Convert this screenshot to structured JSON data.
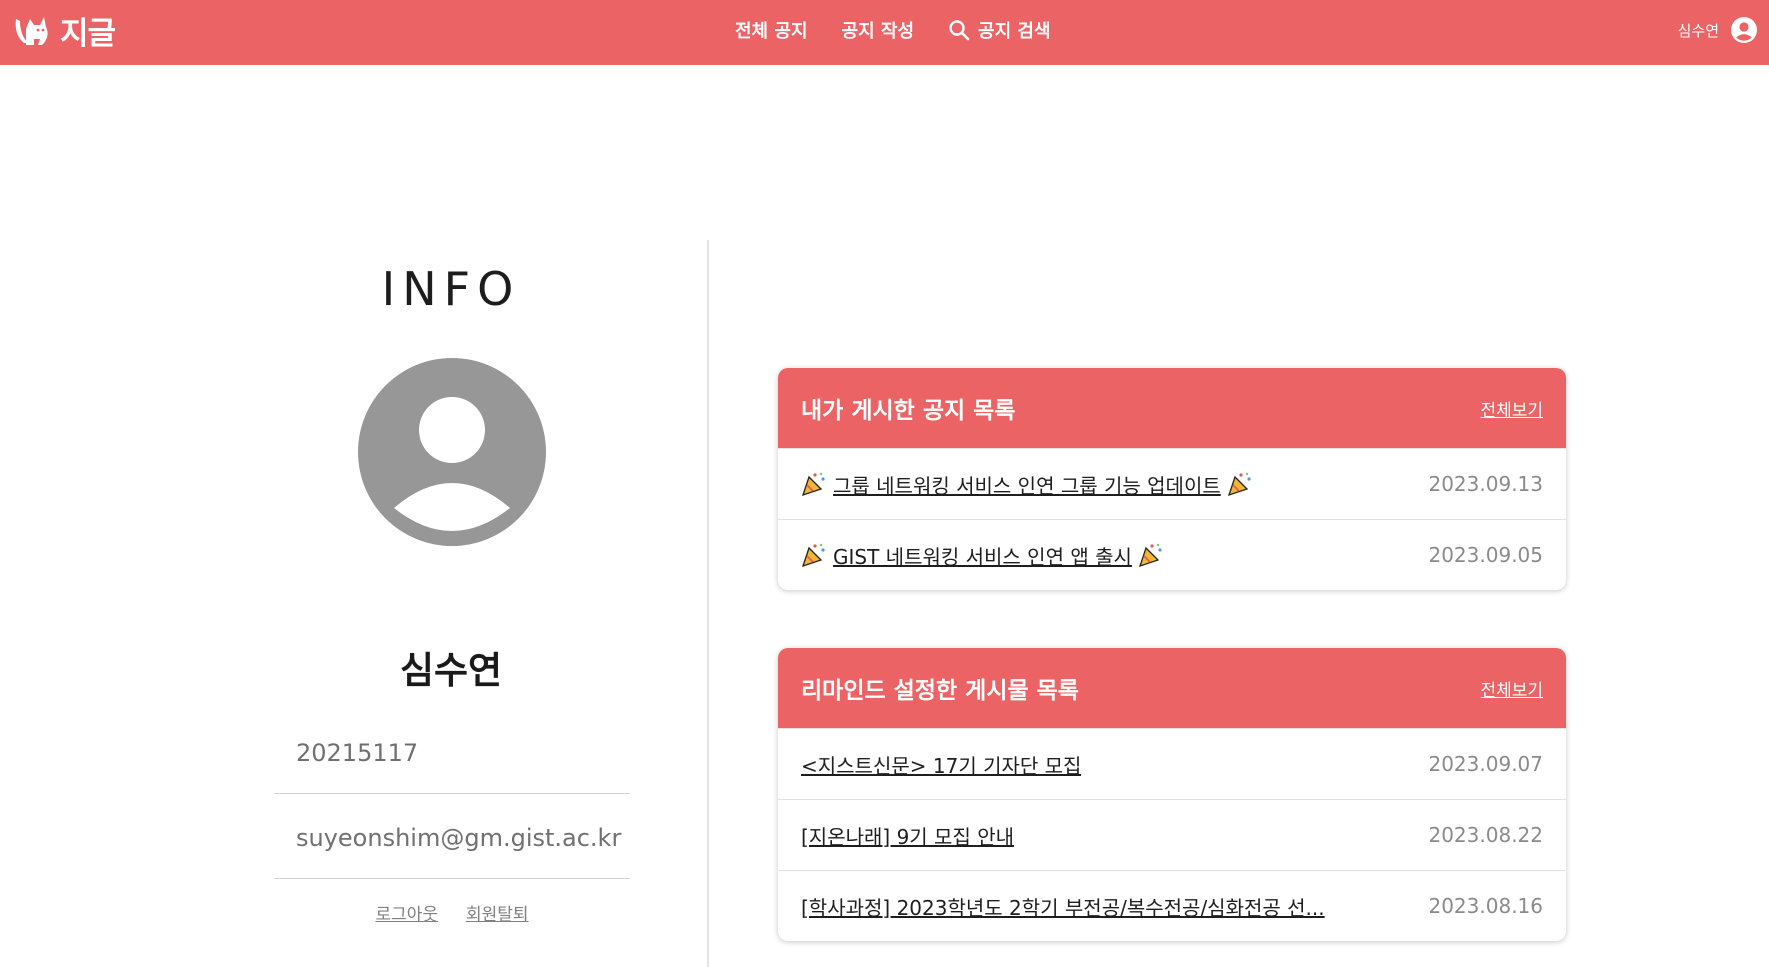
{
  "nav": {
    "logo_text": "지글",
    "links": [
      {
        "label": "전체 공지"
      },
      {
        "label": "공지 작성"
      },
      {
        "label": "공지 검색"
      }
    ],
    "user_name": "심수연"
  },
  "profile": {
    "heading": "INFO",
    "name": "심수연",
    "student_id": "20215117",
    "email": "suyeonshim@gm.gist.ac.kr",
    "logout_label": "로그아웃",
    "withdraw_label": "회원탈퇴"
  },
  "my_posts": {
    "title": "내가 게시한 공지 목록",
    "view_all": "전체보기",
    "items": [
      {
        "title": "그룹 네트워킹 서비스 인연 그룹 기능 업데이트",
        "date": "2023.09.13"
      },
      {
        "title": "GIST 네트워킹 서비스 인연 앱 출시",
        "date": "2023.09.05"
      }
    ]
  },
  "reminders": {
    "title": "리마인드 설정한 게시물 목록",
    "view_all": "전체보기",
    "items": [
      {
        "title": "<지스트신문> 17기 기자단 모집",
        "date": "2023.09.07"
      },
      {
        "title": "[지온나래] 9기 모집 안내",
        "date": "2023.08.22"
      },
      {
        "title": "[학사과정] 2023학년도 2학기 부전공/복수전공/심화전공 선...",
        "date": "2023.08.16"
      }
    ]
  },
  "colors": {
    "brand": "#EB6365",
    "text_muted": "#8a8a8a"
  },
  "icons": [
    "cat-logo-icon",
    "search-icon",
    "user-circle-icon",
    "avatar-icon",
    "party-popper-icon"
  ]
}
